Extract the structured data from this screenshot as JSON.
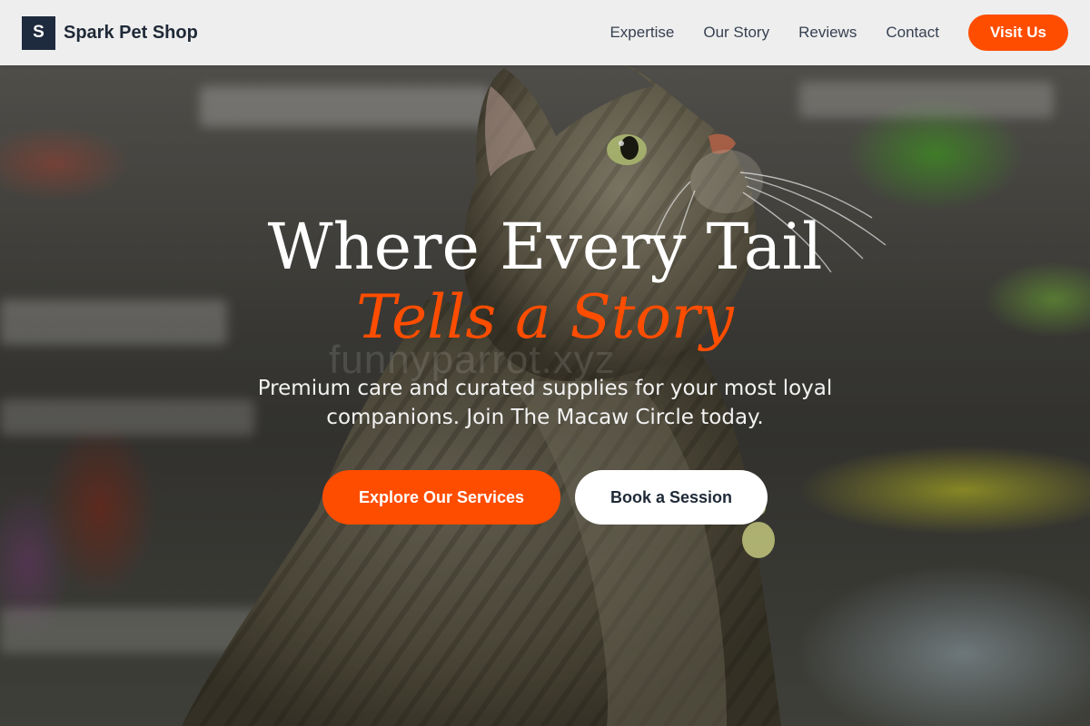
{
  "brand": {
    "initial": "S",
    "name": "Spark Pet Shop"
  },
  "nav": {
    "items": [
      {
        "label": "Expertise"
      },
      {
        "label": "Our Story"
      },
      {
        "label": "Reviews"
      },
      {
        "label": "Contact"
      }
    ],
    "cta_label": "Visit Us"
  },
  "hero": {
    "headline_line1": "Where Every Tail",
    "headline_line2": "Tells a Story",
    "watermark": "funnyparrot.xyz",
    "subtitle": "Premium care and curated supplies for your most loyal companions. Join The Macaw Circle today.",
    "primary_cta": "Explore Our Services",
    "secondary_cta": "Book a Session",
    "background_image": "tabby-cat-in-pet-shop"
  },
  "colors": {
    "accent": "#ff4d00",
    "brand_dark": "#1e2a3d",
    "header_bg": "#f5f5f5",
    "text_dark": "#1f2937"
  }
}
